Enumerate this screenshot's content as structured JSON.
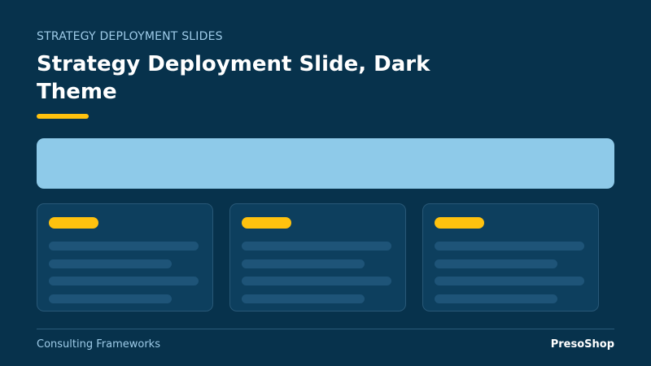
{
  "slide": {
    "eyebrow": "STRATEGY DEPLOYMENT SLIDES",
    "title": "Strategy Deployment Slide, Dark Theme"
  },
  "footer": {
    "left": "Consulting Frameworks",
    "right": "PresoShop"
  },
  "colors": {
    "background": "#07324c",
    "accent": "#ffc20e",
    "hero_band": "#8ecae9",
    "card": "#0d3f5e",
    "placeholder_line": "#1e5478"
  }
}
